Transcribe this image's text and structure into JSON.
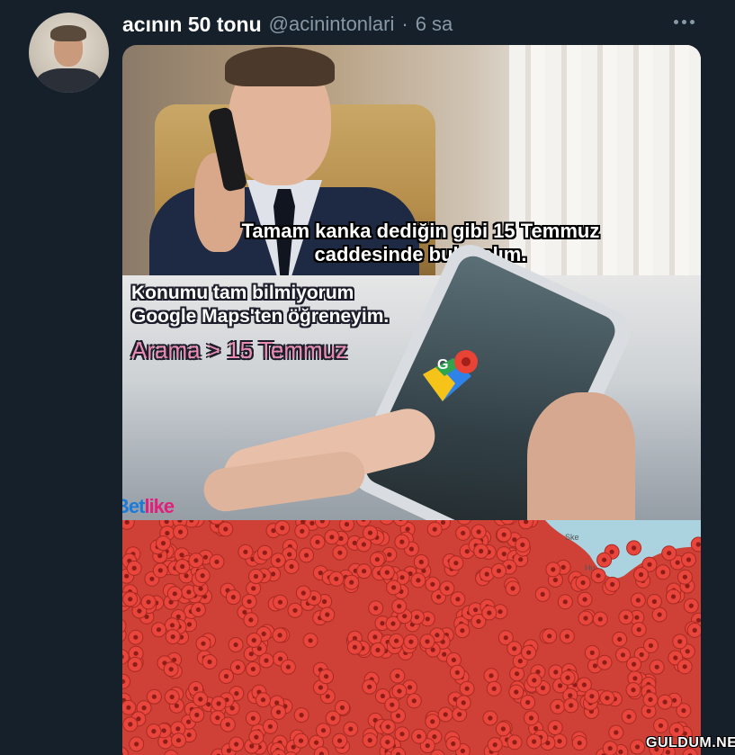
{
  "tweet": {
    "display_name": "acının 50 tonu",
    "handle": "@acinintonlari",
    "separator": "·",
    "time": "6 sa"
  },
  "icons": {
    "more": "more-horizontal-icon",
    "maps": "google-maps-icon"
  },
  "meme": {
    "panel1_caption_line1": "Tamam kanka dediğin gibi 15 Temmuz",
    "panel1_caption_line2": "caddesinde buluşalım.",
    "panel2_line1": "Konumu tam bilmiyorum",
    "panel2_line2": "Google Maps'ten öğreneyim.",
    "panel2_line3": "Arama > 15 Temmuz",
    "watermark_a": "Bet",
    "watermark_b": "like",
    "map_label_1": "Ske",
    "map_label_2": "Hu"
  },
  "footer_watermark": "GULDUM.NET",
  "colors": {
    "background": "#15202b",
    "secondary_text": "#8899a6",
    "pin_red": "#e8453c"
  }
}
